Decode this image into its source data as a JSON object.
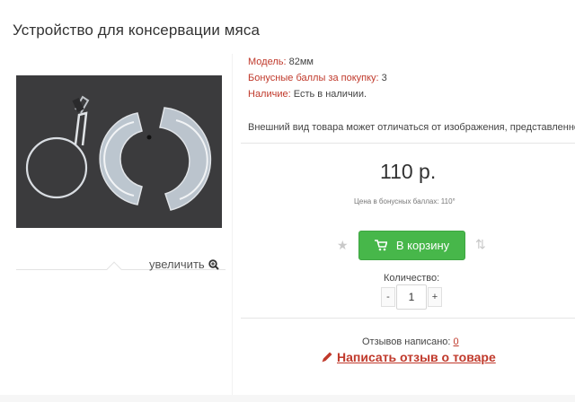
{
  "product": {
    "title": "Устройство для консервации мяса",
    "zoom_label": "увеличить",
    "meta": [
      {
        "label": "Модель:",
        "value": "82мм"
      },
      {
        "label": "Бонусные баллы за покупку:",
        "value": "3"
      },
      {
        "label": "Наличие:",
        "value": "Есть в наличии."
      }
    ],
    "notice": "Внешний вид товара может отличаться от изображения, представленного на сайте.",
    "price": "110 р.",
    "bonus_price": "Цена в бонусных баллах: 110°",
    "cart_label": "В корзину",
    "qty_label": "Количество:",
    "qty_value": "1",
    "qty_minus": "-",
    "qty_plus": "+",
    "reviews_label": "Отзывов написано:",
    "reviews_count": "0",
    "write_review": "Написать отзыв о товаре"
  },
  "icons": {
    "star": "star-icon",
    "cart": "cart-icon",
    "compare": "compare-icon",
    "zoom": "magnifier-plus-icon",
    "pencil": "pencil-icon"
  },
  "colors": {
    "accent_red": "#c0392b",
    "button_green": "#47b74a",
    "image_bg": "#3b3b3d"
  }
}
